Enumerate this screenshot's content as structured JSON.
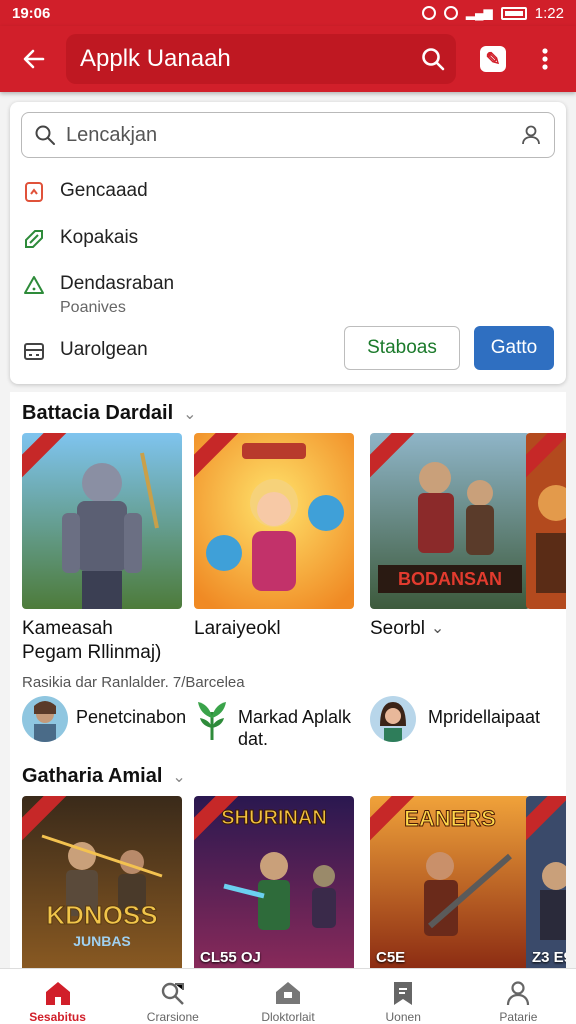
{
  "status_bar": {
    "time_left": "19:06",
    "time_right": "1:22"
  },
  "app_bar": {
    "title": "Applk Uanaah"
  },
  "search": {
    "placeholder": "Lencakjan"
  },
  "menu": {
    "items": [
      {
        "label": "Gencaaad"
      },
      {
        "label": "Kopakais"
      },
      {
        "label": "Dendasraban",
        "sublabel": "Poanives"
      },
      {
        "label": "Uarolgean"
      }
    ],
    "secondary_button": "Staboas",
    "primary_button": "Gatto"
  },
  "section1": {
    "title": "Battacia Dardail",
    "games": [
      {
        "title_line1": "Kameasah",
        "title_line2": "Pegam Rllinmaj)"
      },
      {
        "title_line1": "Laraiyeokl"
      },
      {
        "title_line1": "Seorbl",
        "has_dropdown": true
      },
      {
        "title_line1": ""
      }
    ],
    "meta": "Rasikia dar Ranlalder. 7/Barcelea",
    "creators": [
      {
        "name": "Penetcinabon",
        "icon": "avatar-warrior"
      },
      {
        "name_line1": "Markad Aplalk",
        "name_line2": "dat.",
        "icon": "plant-icon"
      },
      {
        "name": "Mpridellaipaat",
        "icon": "avatar-woman"
      }
    ]
  },
  "section2": {
    "title": "Gatharia Amial",
    "games": [
      {
        "art_text_line1": "KDNOSS",
        "art_text_line2": "JUNBAS"
      },
      {
        "art_text": "SHURINAN",
        "price": "CL55 OJ"
      },
      {
        "art_text": "EANERS",
        "price": "C5E"
      },
      {
        "price": "Z3 E9"
      }
    ]
  },
  "bottom_nav": {
    "items": [
      {
        "label": "Sesabitus",
        "icon": "home-icon",
        "active": true
      },
      {
        "label": "Crarsione",
        "icon": "search-tag-icon"
      },
      {
        "label": "Dloktorlait",
        "icon": "store-icon"
      },
      {
        "label": "Uonen",
        "icon": "bookmark-icon"
      },
      {
        "label": "Patarie",
        "icon": "profile-icon"
      }
    ]
  },
  "colors": {
    "brand": "#d11f2a",
    "primary_button": "#2f6fc1",
    "secondary_text": "#1b7a2b"
  }
}
